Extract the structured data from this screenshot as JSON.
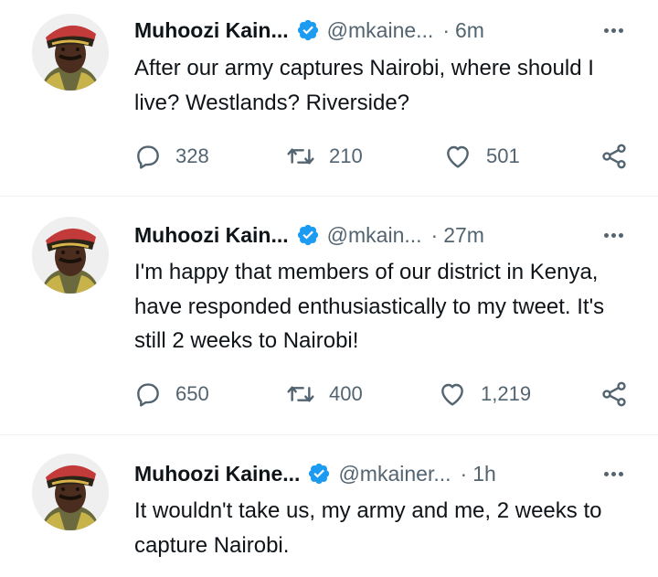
{
  "tweets": [
    {
      "display_name": "Muhoozi Kain...",
      "handle": "@mkaine...",
      "time": "6m",
      "text": "After our army captures Nairobi, where should I live? Westlands? Riverside?",
      "replies": "328",
      "retweets": "210",
      "likes": "501"
    },
    {
      "display_name": "Muhoozi Kain...",
      "handle": "@mkain...",
      "time": "27m",
      "text": "I'm happy that members of our district in Kenya, have responded enthusiastically to my tweet. It's still 2 weeks to Nairobi!",
      "replies": "650",
      "retweets": "400",
      "likes": "1,219"
    },
    {
      "display_name": "Muhoozi Kaine...",
      "handle": "@mkainer...",
      "time": "1h",
      "text": "It wouldn't take us, my army and me, 2 weeks to capture Nairobi."
    }
  ],
  "separator": "·",
  "icons": {
    "reply": "reply-icon",
    "retweet": "retweet-icon",
    "like": "heart-icon",
    "share": "share-icon",
    "more": "more-icon",
    "verified": "verified-badge-icon"
  },
  "colors": {
    "verified": "#1d9bf0",
    "muted": "#536471",
    "text": "#0f1419",
    "divider": "#eff3f4"
  }
}
